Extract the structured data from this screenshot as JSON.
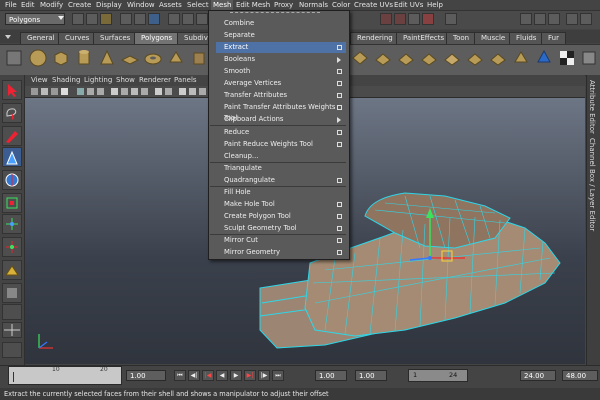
{
  "menubar": [
    "File",
    "Edit",
    "Modify",
    "Create",
    "Display",
    "Window",
    "Assets",
    "Select",
    "Mesh",
    "Edit Mesh",
    "Proxy",
    "Normals",
    "Color",
    "Create UVs",
    "Edit UVs",
    "Help"
  ],
  "mode_select": "Polygons",
  "shelf_tabs": [
    "General",
    "Curves",
    "Surfaces",
    "Polygons",
    "Subdivs",
    "Rendering",
    "PaintEffects",
    "Toon",
    "Muscle",
    "Fluids",
    "Fur"
  ],
  "active_shelf_tab": "Polygons",
  "panel_menu": [
    "View",
    "Shading",
    "Lighting",
    "Show",
    "Renderer",
    "Panels"
  ],
  "mesh_menu": {
    "items": [
      {
        "label": "Combine",
        "option": false,
        "submenu": false
      },
      {
        "label": "Separate",
        "option": false,
        "submenu": false
      },
      {
        "label": "Extract",
        "option": true,
        "submenu": false,
        "highlighted": true
      },
      {
        "label": "Booleans",
        "option": false,
        "submenu": true
      },
      {
        "label": "Smooth",
        "option": true,
        "submenu": false
      },
      {
        "label": "Average Vertices",
        "option": true,
        "submenu": false
      },
      {
        "label": "Transfer Attributes",
        "option": true,
        "submenu": false
      },
      {
        "label": "Paint Transfer Attributes Weights Tool",
        "option": true,
        "submenu": false
      },
      {
        "label": "Clipboard Actions",
        "option": false,
        "submenu": true
      },
      {
        "label": "Reduce",
        "option": true,
        "submenu": false
      },
      {
        "label": "Paint Reduce Weights Tool",
        "option": true,
        "submenu": false
      },
      {
        "label": "Cleanup...",
        "option": false,
        "submenu": false
      },
      {
        "label": "Triangulate",
        "option": false,
        "submenu": false
      },
      {
        "label": "Quadrangulate",
        "option": true,
        "submenu": false
      },
      {
        "label": "Fill Hole",
        "option": false,
        "submenu": false
      },
      {
        "label": "Make Hole Tool",
        "option": true,
        "submenu": false
      },
      {
        "label": "Create Polygon Tool",
        "option": true,
        "submenu": false
      },
      {
        "label": "Sculpt Geometry Tool",
        "option": true,
        "submenu": false
      },
      {
        "label": "Mirror Cut",
        "option": true,
        "submenu": false
      },
      {
        "label": "Mirror Geometry",
        "option": true,
        "submenu": false
      }
    ]
  },
  "side_tabs": [
    "Attribute Editor",
    "Channel Box / Layer Editor"
  ],
  "timeline": {
    "ticks": [
      "10",
      "20"
    ],
    "current_time": "1.00",
    "range_start": "1.00",
    "anim_start": "1.00",
    "range_slider_start": "1",
    "range_slider_end": "24",
    "range_end": "24.00",
    "anim_end": "48.00"
  },
  "help_line": "Extract the currently selected faces from their shell and shows a manipulator to adjust their offset",
  "colors": {
    "accent_highlight": "#4f72a6",
    "wireframe": "#2ed6e8",
    "mesh": "#9c8673",
    "viewport_top": "#6d7685",
    "viewport_bottom": "#2f343d"
  }
}
